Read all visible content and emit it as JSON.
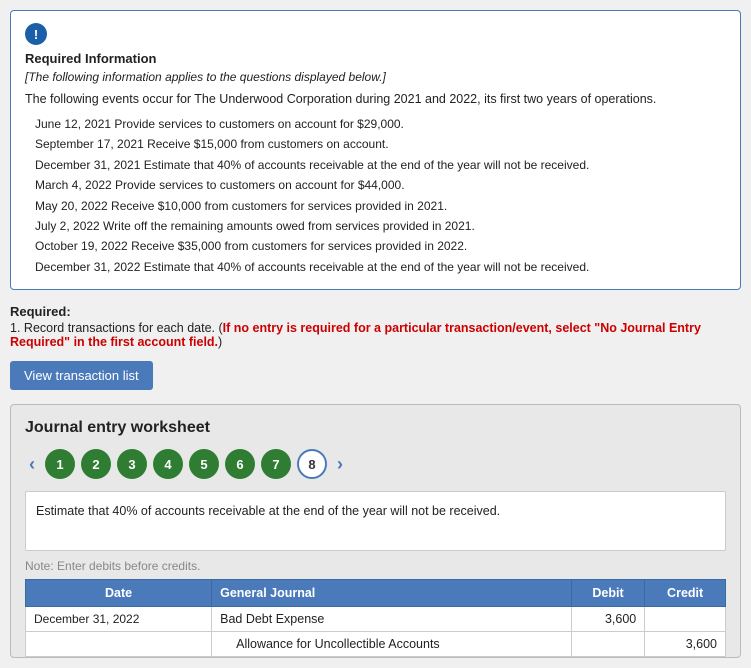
{
  "info": {
    "icon": "!",
    "title": "Required Information",
    "subtitle": "[The following information applies to the questions displayed below.]",
    "intro": "The following events occur for The Underwood Corporation during 2021 and 2022, its first two years of operations.",
    "events": [
      "June 12, 2021 Provide services to customers on account for $29,000.",
      "September 17, 2021 Receive $15,000 from customers on account.",
      "December 31, 2021 Estimate that 40% of accounts receivable at the end of the year will not be received.",
      "March 4, 2022 Provide services to customers on account for $44,000.",
      "May 20, 2022 Receive $10,000 from customers for services provided in 2021.",
      "July 2, 2022 Write off the remaining amounts owed from services provided in 2021.",
      "October 19, 2022 Receive $35,000 from customers for services provided in 2022.",
      "December 31, 2022 Estimate that 40% of accounts receivable at the end of the year will not be received."
    ]
  },
  "required": {
    "label": "Required:",
    "number": "1.",
    "text_normal": "Record transactions for each date. (",
    "text_bold_red": "If no entry is required for a particular transaction/event, select \"No Journal Entry Required\" in the first account field.",
    "text_end": ")"
  },
  "btn_view": "View transaction list",
  "worksheet": {
    "title": "Journal entry worksheet",
    "nav_buttons": [
      "1",
      "2",
      "3",
      "4",
      "5",
      "6",
      "7",
      "8"
    ],
    "active_index": 7,
    "description": "Estimate that 40% of accounts receivable at the end of the year will not be received.",
    "note": "Note: Enter debits before credits.",
    "table": {
      "headers": [
        "Date",
        "General Journal",
        "Debit",
        "Credit"
      ],
      "rows": [
        {
          "date": "December 31, 2022",
          "account": "Bad Debt Expense",
          "debit": "3,600",
          "credit": "",
          "indent": false
        },
        {
          "date": "",
          "account": "Allowance for Uncollectible Accounts",
          "debit": "",
          "credit": "3,600",
          "indent": true
        }
      ]
    }
  }
}
